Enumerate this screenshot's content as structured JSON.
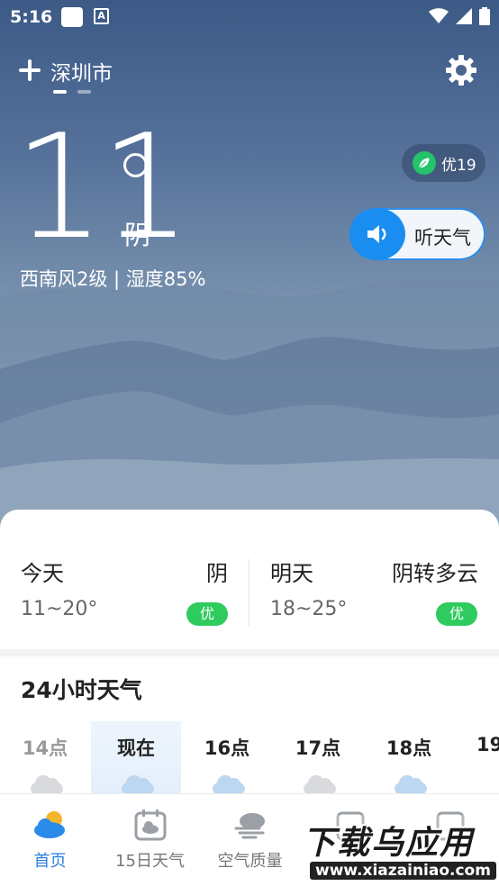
{
  "status_bar": {
    "time": "5:16",
    "a_icon": "A"
  },
  "header": {
    "city": "深圳市"
  },
  "current": {
    "temperature": "11",
    "condition": "阴",
    "details": "西南风2级 | 湿度85%",
    "aqi": "优19",
    "listen_label": "听天气"
  },
  "forecast": {
    "today": {
      "name": "今天",
      "condition": "阴",
      "range": "11~20°",
      "aqi": "优"
    },
    "tomorrow": {
      "name": "明天",
      "condition": "阴转多云",
      "range": "18~25°",
      "aqi": "优"
    }
  },
  "hourly": {
    "title": "24小时天气",
    "hours": [
      {
        "label": "14点"
      },
      {
        "label": "现在"
      },
      {
        "label": "16点"
      },
      {
        "label": "17点"
      },
      {
        "label": "18点"
      },
      {
        "label": "19"
      }
    ]
  },
  "tabs": [
    {
      "label": "首页",
      "icon": "cloud-sun-icon"
    },
    {
      "label": "15日天气",
      "icon": "calendar-icon"
    },
    {
      "label": "空气质量",
      "icon": "wind-icon"
    },
    {
      "label": "",
      "icon": "calendar-icon"
    },
    {
      "label": "",
      "icon": "almanac-icon"
    }
  ],
  "watermark": {
    "text": "下载乌应用",
    "url": "www.xiazainiao.com"
  },
  "colors": {
    "accent": "#1a8ef0",
    "aqi_good": "#2ecb5e",
    "tab_active": "#2b7fe0"
  }
}
